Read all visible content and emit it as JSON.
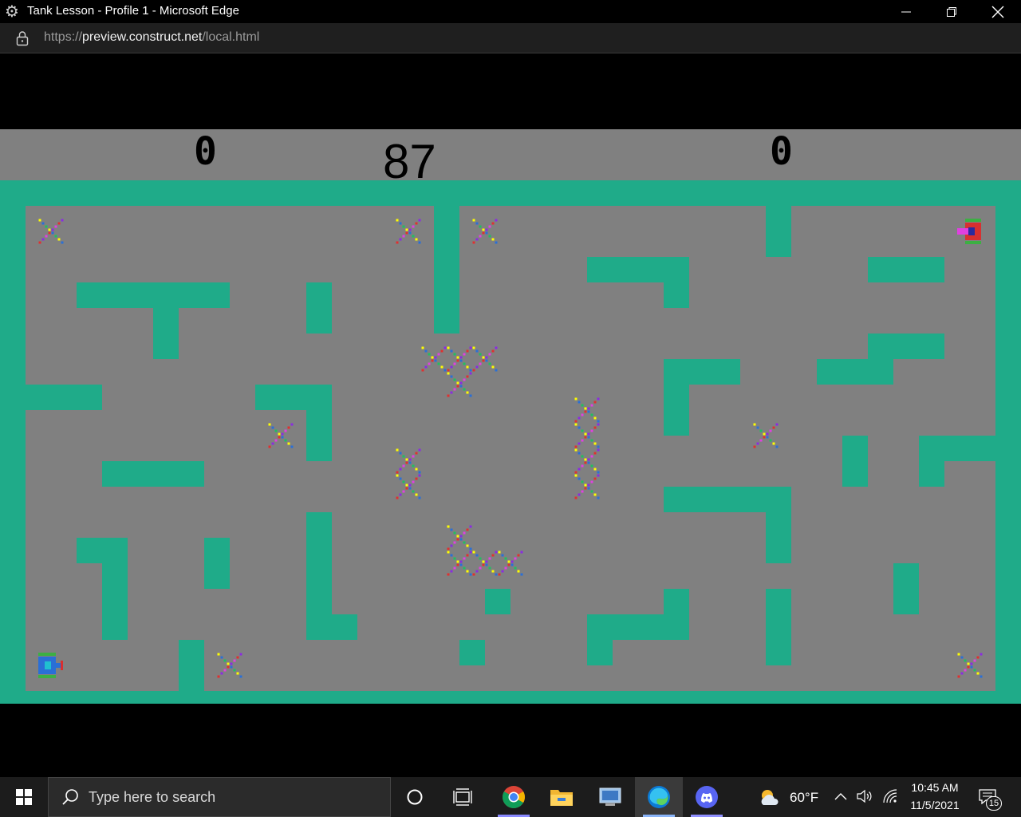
{
  "window": {
    "title": "Tank Lesson - Profile 1 - Microsoft Edge"
  },
  "address": {
    "scheme": "https://",
    "host": "preview.construct.net",
    "path": "/local.html"
  },
  "game": {
    "player1_score": "0",
    "player2_score": "0",
    "timer": "87"
  },
  "taskbar": {
    "search_placeholder": "Type here to search",
    "weather_temp": "60°F",
    "clock_time": "10:45 AM",
    "clock_date": "11/5/2021",
    "notification_count": "15"
  },
  "colors": {
    "wall": "#1fab89",
    "floor": "#808080",
    "blue_tank": "#2a6fd6",
    "red_tank": "#d83030"
  },
  "icons": {
    "window_icon": "gear-icon",
    "lock": "lock-icon",
    "start": "windows-logo-icon",
    "search": "search-icon",
    "cortana": "cortana-circle-icon",
    "task_view": "task-view-icon",
    "chrome": "chrome-icon",
    "explorer": "file-explorer-icon",
    "remote": "remote-desktop-icon",
    "edge": "edge-icon",
    "discord": "discord-icon",
    "weather": "weather-partly-cloudy-icon",
    "notifications": "notification-center-icon"
  }
}
